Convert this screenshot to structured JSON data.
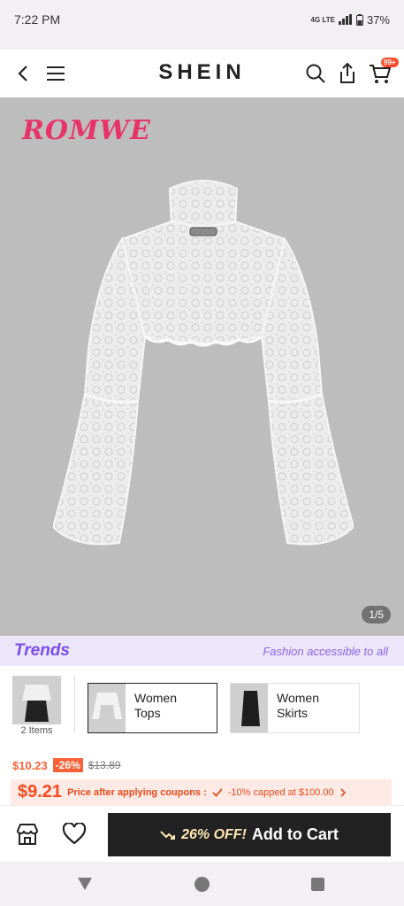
{
  "status": {
    "time": "7:22 PM",
    "network": "4G LTE",
    "battery": "37%"
  },
  "header": {
    "brand": "SHEIN",
    "cart_badge": "99+"
  },
  "hero": {
    "brand_logo": "ROMWE",
    "pager": "1/5"
  },
  "trends": {
    "logo": "Trends",
    "tagline": "Fashion accessible to all"
  },
  "outfit": {
    "items_count": "2 Items",
    "categories": [
      {
        "label_line1": "Women",
        "label_line2": "Tops"
      },
      {
        "label_line1": "Women",
        "label_line2": "Skirts"
      }
    ]
  },
  "price": {
    "current": "$10.23",
    "discount": "-26%",
    "original": "$13.89",
    "coupon_price": "$9.21",
    "coupon_label": "Price after applying coupons :",
    "coupon_detail": "-10% capped at $100.00"
  },
  "cta": {
    "off_label": "26% OFF!",
    "add_label": "Add to Cart"
  },
  "colors": {
    "accent": "#fa6338",
    "brand_pink": "#e8336a",
    "trends_purple": "#7b4ce8",
    "dark_button": "#222222"
  },
  "icons": [
    "back-arrow-icon",
    "menu-icon",
    "search-icon",
    "share-icon",
    "cart-icon",
    "store-icon",
    "heart-icon",
    "trend-down-icon",
    "check-icon",
    "chevron-right-icon"
  ]
}
